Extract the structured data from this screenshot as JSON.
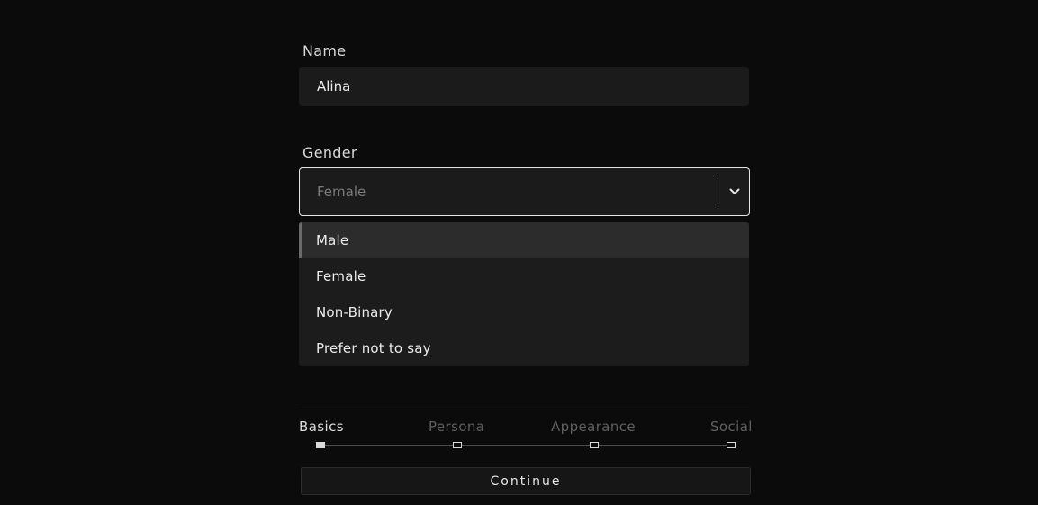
{
  "form": {
    "name_label": "Name",
    "name_value": "Alina",
    "gender_label": "Gender",
    "gender_placeholder": "Female",
    "gender_chevron_icon": "chevron-down-icon"
  },
  "gender_menu": {
    "options": [
      "Male",
      "Female",
      "Non-Binary",
      "Prefer not to say"
    ],
    "highlighted_index": 0
  },
  "stepper": {
    "steps": [
      "Basics",
      "Persona",
      "Appearance",
      "Social"
    ],
    "current_index": 0
  },
  "actions": {
    "continue_label": "Continue"
  },
  "colors": {
    "background": "#0b0b0b",
    "field": "#1b1b1b",
    "text": "#e6e6e6",
    "muted": "#5f5f5f"
  }
}
